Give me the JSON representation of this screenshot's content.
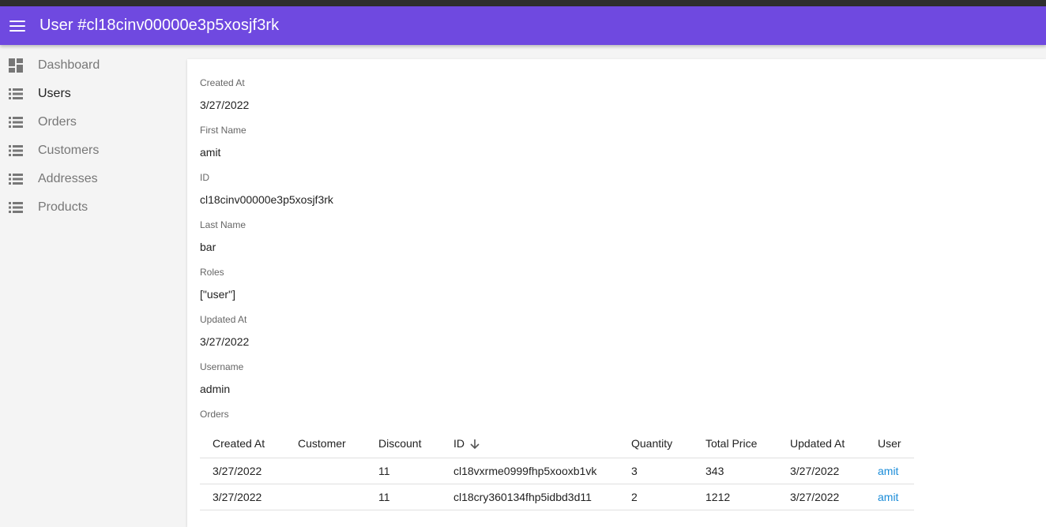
{
  "header": {
    "title": "User #cl18cinv00000e3p5xosjf3rk",
    "menu_icon": "menu-icon"
  },
  "sidebar": {
    "items": [
      {
        "label": "Dashboard",
        "icon": "dashboard-icon",
        "active": false
      },
      {
        "label": "Users",
        "icon": "list-icon",
        "active": true
      },
      {
        "label": "Orders",
        "icon": "list-icon",
        "active": false
      },
      {
        "label": "Customers",
        "icon": "list-icon",
        "active": false
      },
      {
        "label": "Addresses",
        "icon": "list-icon",
        "active": false
      },
      {
        "label": "Products",
        "icon": "list-icon",
        "active": false
      }
    ]
  },
  "fields": [
    {
      "label": "Created At",
      "value": "3/27/2022"
    },
    {
      "label": "First Name",
      "value": "amit"
    },
    {
      "label": "ID",
      "value": "cl18cinv00000e3p5xosjf3rk"
    },
    {
      "label": "Last Name",
      "value": "bar"
    },
    {
      "label": "Roles",
      "value": "[\"user\"]"
    },
    {
      "label": "Updated At",
      "value": "3/27/2022"
    },
    {
      "label": "Username",
      "value": "admin"
    }
  ],
  "orders": {
    "label": "Orders",
    "columns": [
      "Created At",
      "Customer",
      "Discount",
      "ID",
      "Quantity",
      "Total Price",
      "Updated At",
      "User"
    ],
    "sort_column": "ID",
    "sort_direction": "descending",
    "rows": [
      [
        "3/27/2022",
        "",
        "11",
        "cl18vxrme0999fhp5xooxb1vk",
        "3",
        "343",
        "3/27/2022",
        "amit"
      ],
      [
        "3/27/2022",
        "",
        "11",
        "cl18cry360134fhp5idbd3d11",
        "2",
        "1212",
        "3/27/2022",
        "amit"
      ]
    ]
  },
  "colors": {
    "app_bar": "#6f49e0",
    "link": "#1a8cd8",
    "sidebar_bg": "#f4f4f4"
  }
}
